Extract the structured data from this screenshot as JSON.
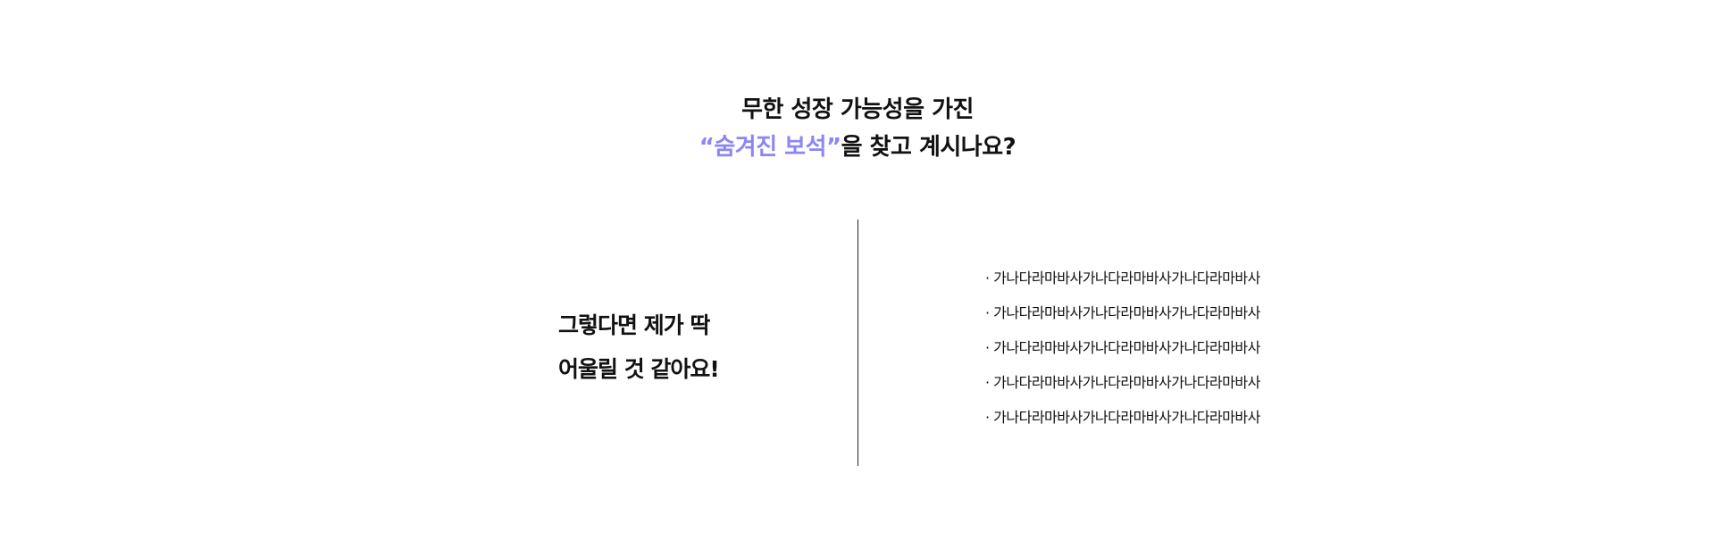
{
  "heading": {
    "line1": "무한 성장 가능성을 가진",
    "highlight": "“숨겨진 보석”",
    "line2_rest": "을 찾고 계시나요?",
    "accent_color": "#8c86f4"
  },
  "intro": {
    "line1": "그렇다면 제가 딱",
    "line2": "어울릴 것 같아요!"
  },
  "list": {
    "items": [
      "가나다라마바사가나다라마바사가나다라마바사",
      "가나다라마바사가나다라마바사가나다라마바사",
      "가나다라마바사가나다라마바사가나다라마바사",
      "가나다라마바사가나다라마바사가나다라마바사",
      "가나다라마바사가나다라마바사가나다라마바사"
    ]
  }
}
